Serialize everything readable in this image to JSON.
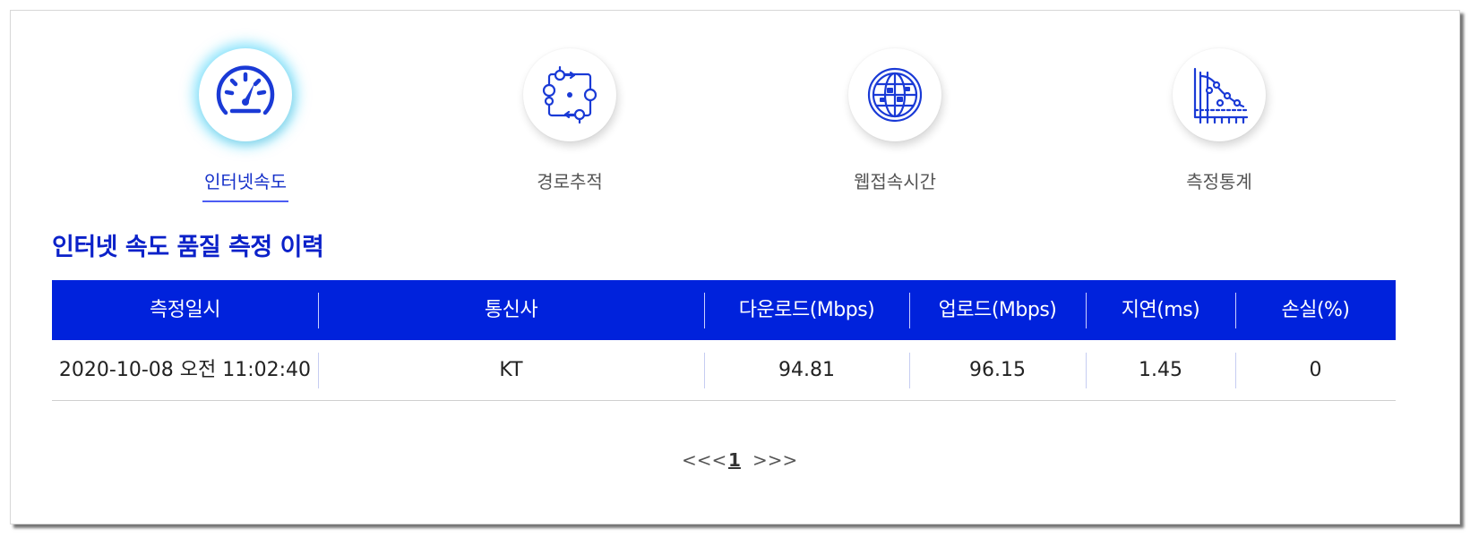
{
  "tabs": [
    {
      "label": "인터넷속도",
      "icon": "speedometer-icon",
      "active": true
    },
    {
      "label": "경로추적",
      "icon": "route-trace-icon",
      "active": false
    },
    {
      "label": "웹접속시간",
      "icon": "globe-icon",
      "active": false
    },
    {
      "label": "측정통계",
      "icon": "statistics-chart-icon",
      "active": false
    }
  ],
  "section": {
    "title": "인터넷 속도 품질 측정 이력"
  },
  "table": {
    "columns": [
      "측정일시",
      "통신사",
      "다운로드(Mbps)",
      "업로드(Mbps)",
      "지연(ms)",
      "손실(%)"
    ],
    "rows": [
      [
        "2020-10-08 오전 11:02:40",
        "KT",
        "94.81",
        "96.15",
        "1.45",
        "0"
      ]
    ]
  },
  "pagination": {
    "prev": "<<<",
    "current": "1",
    "next": ">>>"
  },
  "colors": {
    "accent_blue": "#0022dc",
    "title_blue": "#0b21c9",
    "active_tab_text": "#1631c9",
    "icon_blue": "#1a3ad6",
    "active_glow": "#2ecdfa"
  }
}
